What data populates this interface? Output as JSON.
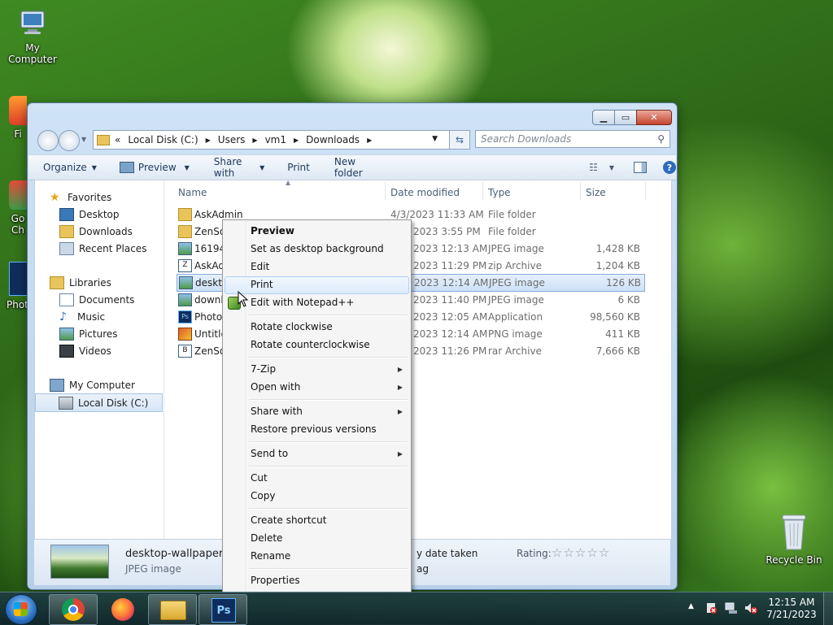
{
  "desktop": {
    "icons": {
      "my_computer": "My Computer",
      "recycle_bin": "Recycle Bin",
      "partial_1": "Fi",
      "partial_2": "Go",
      "partial_3": "Ch",
      "partial_4": "Photo"
    }
  },
  "window": {
    "address": {
      "chevron": "«",
      "crumbs": [
        "Local Disk (C:)",
        "Users",
        "vm1",
        "Downloads"
      ]
    },
    "search_placeholder": "Search Downloads",
    "toolbar": {
      "organize": "Organize",
      "preview": "Preview",
      "share_with": "Share with",
      "print": "Print",
      "new_folder": "New folder"
    },
    "nav": {
      "favorites": "Favorites",
      "desktop": "Desktop",
      "downloads": "Downloads",
      "recent_places": "Recent Places",
      "libraries": "Libraries",
      "documents": "Documents",
      "music": "Music",
      "pictures": "Pictures",
      "videos": "Videos",
      "my_computer": "My Computer",
      "local_disk": "Local Disk (C:)"
    },
    "columns": {
      "name": "Name",
      "date_modified": "Date modified",
      "type": "Type",
      "size": "Size"
    },
    "files": [
      {
        "name": "AskAdmin",
        "date": "4/3/2023 11:33 AM",
        "type": "File folder",
        "size": ""
      },
      {
        "name": "ZenSo",
        "date": "2023 3:55 PM",
        "type": "File folder",
        "size": ""
      },
      {
        "name": "161941",
        "date": "2023 12:13 AM",
        "type": "JPEG image",
        "size": "1,428 KB"
      },
      {
        "name": "AskAd",
        "date": "2023 11:29 PM",
        "type": "zip Archive",
        "size": "1,204 KB"
      },
      {
        "name": "deskto",
        "date": "2023 12:14 AM",
        "type": "JPEG image",
        "size": "126 KB"
      },
      {
        "name": "downl",
        "date": "2023 11:40 PM",
        "type": "JPEG image",
        "size": "6 KB"
      },
      {
        "name": "Photos",
        "date": "2023 12:05 AM",
        "type": "Application",
        "size": "98,560 KB"
      },
      {
        "name": "Untitle",
        "date": "2023 12:14 AM",
        "type": "PNG image",
        "size": "411 KB"
      },
      {
        "name": "ZenSo",
        "date": "2023 11:26 PM",
        "type": "rar Archive",
        "size": "7,666 KB"
      }
    ],
    "status": {
      "filename": "desktop-wallpaper-ju",
      "filetype": "JPEG image",
      "date_taken": "y date taken",
      "tags": "ag",
      "rating_label": "Rating:",
      "stars": "☆☆☆☆☆"
    }
  },
  "context_menu": {
    "preview": "Preview",
    "set_bg": "Set as desktop background",
    "edit": "Edit",
    "print": "Print",
    "notepad": "Edit with Notepad++",
    "rotate_cw": "Rotate clockwise",
    "rotate_ccw": "Rotate counterclockwise",
    "seven_zip": "7-Zip",
    "open_with": "Open with",
    "share_with": "Share with",
    "restore": "Restore previous versions",
    "send_to": "Send to",
    "cut": "Cut",
    "copy": "Copy",
    "create_shortcut": "Create shortcut",
    "delete": "Delete",
    "rename": "Rename",
    "properties": "Properties"
  },
  "taskbar": {
    "time": "12:15 AM",
    "date": "7/21/2023",
    "ps_label": "Ps"
  },
  "colors": {
    "accent": "#3399ff",
    "menu_highlight": "#dcebfc",
    "taskbar": "#1a3a48"
  }
}
